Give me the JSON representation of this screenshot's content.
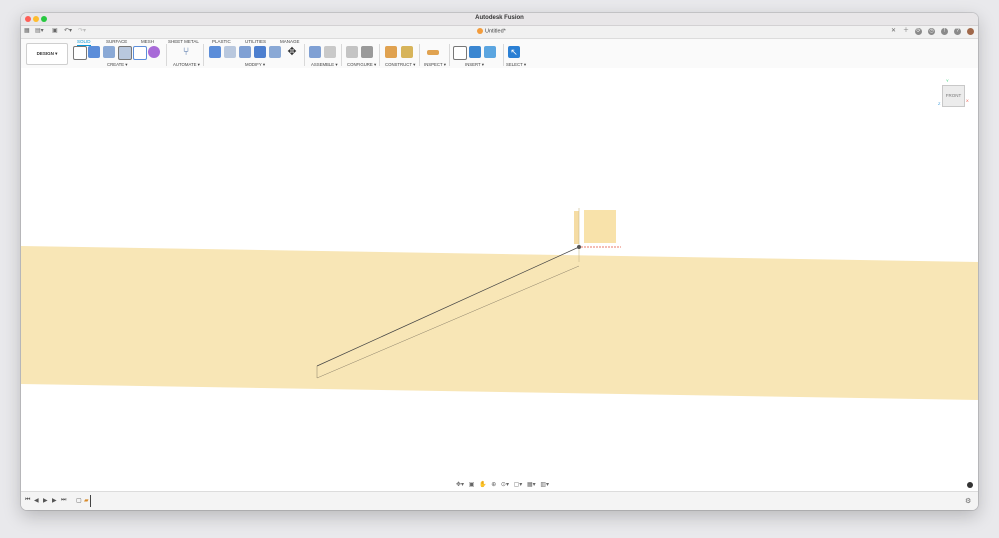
{
  "window": {
    "title": "Autodesk Fusion"
  },
  "document_tab": {
    "label": "Untitled*"
  },
  "workspace_button": {
    "label": "DESIGN ▾"
  },
  "ribbon_tabs": [
    {
      "label": "SOLID",
      "active": true
    },
    {
      "label": "SURFACE"
    },
    {
      "label": "MESH"
    },
    {
      "label": "SHEET METAL"
    },
    {
      "label": "PLASTIC"
    },
    {
      "label": "UTILITIES"
    },
    {
      "label": "MANAGE"
    }
  ],
  "tool_groups": [
    {
      "label": "CREATE ▾"
    },
    {
      "label": "AUTOMATE ▾"
    },
    {
      "label": "MODIFY ▾"
    },
    {
      "label": "ASSEMBLE ▾"
    },
    {
      "label": "CONFIGURE ▾"
    },
    {
      "label": "CONSTRUCT ▾"
    },
    {
      "label": "INSPECT ▾"
    },
    {
      "label": "INSERT ▾"
    },
    {
      "label": "SELECT ▾"
    }
  ],
  "viewcube": {
    "face_label": "FRONT",
    "x": "X",
    "y": "Y",
    "z": "Z"
  },
  "colors": {
    "plane": "#f8e6b6",
    "accent": "#0696d7",
    "origin_point": "#555555"
  },
  "icons": {
    "titlebar_left": [
      "grid-icon",
      "file-icon",
      "save-icon",
      "undo-icon",
      "redo-icon"
    ],
    "titlebar_right": [
      "close-tab-icon",
      "new-tab-icon",
      "refresh-icon",
      "jobs-icon",
      "notification-icon",
      "help-icon",
      "avatar"
    ],
    "navbar": [
      "orbit-icon",
      "look-at-icon",
      "pan-icon",
      "zoom-icon",
      "fit-icon",
      "display-settings-icon",
      "grid-settings-icon",
      "viewports-icon"
    ],
    "timeline": [
      "first-icon",
      "prev-icon",
      "play-icon",
      "next-icon",
      "last-icon"
    ]
  }
}
